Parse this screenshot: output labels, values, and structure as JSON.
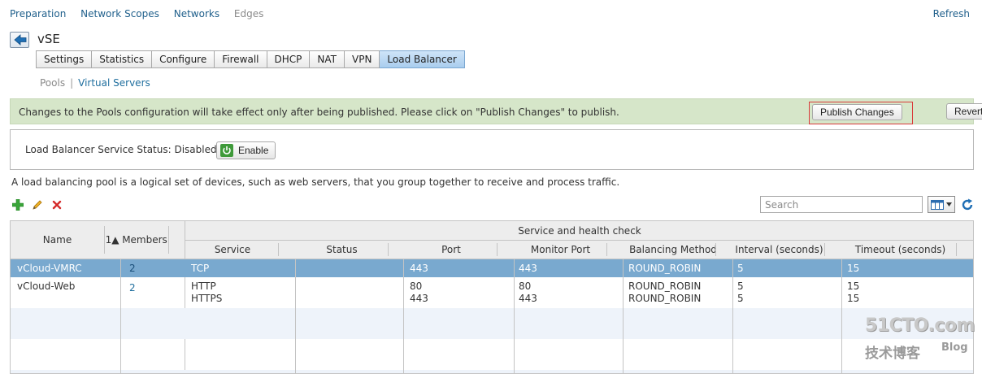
{
  "nav": {
    "links": [
      "Preparation",
      "Network Scopes",
      "Networks",
      "Edges"
    ],
    "refresh": "Refresh"
  },
  "page": {
    "title": "vSE"
  },
  "tabs": [
    "Settings",
    "Statistics",
    "Configure",
    "Firewall",
    "DHCP",
    "NAT",
    "VPN",
    "Load Balancer"
  ],
  "active_tab": "Load Balancer",
  "subnav": {
    "pools": "Pools",
    "virtual_servers": "Virtual Servers"
  },
  "banner": {
    "message": "Changes to the Pools configuration will take effect only after being published. Please click on \"Publish Changes\" to publish.",
    "publish": "Publish Changes",
    "revert": "Revert"
  },
  "service_status": {
    "label": "Load Balancer Service Status:",
    "value": "Disabled",
    "enable": "Enable"
  },
  "description": "A load balancing pool is a logical set of devices, such as web servers, that you group together to receive and process traffic.",
  "search": {
    "placeholder": "Search"
  },
  "colors": {
    "banner": "#d6e6c9",
    "selected_row": "#79a9cf",
    "active_tab": "#a9cdee",
    "publish_outline": "#d93a3a"
  },
  "grid": {
    "group_header": "Service and health check",
    "columns": {
      "name": "Name",
      "sort": "1▲",
      "members": "Members",
      "service": "Service",
      "status": "Status",
      "port": "Port",
      "monitor_port": "Monitor Port",
      "balancing_method": "Balancing Method",
      "interval": "Interval (seconds)",
      "timeout": "Timeout (seconds)"
    },
    "rows": [
      {
        "name": "vCloud-VMRC",
        "members": "2",
        "service": [
          "TCP"
        ],
        "status": "",
        "port": [
          "443"
        ],
        "monitor_port": [
          "443"
        ],
        "method": [
          "ROUND_ROBIN"
        ],
        "interval": [
          "5"
        ],
        "timeout": [
          "15"
        ]
      },
      {
        "name": "vCloud-Web",
        "members": "2",
        "service": [
          "HTTP",
          "HTTPS"
        ],
        "status": "",
        "port": [
          "80",
          "443"
        ],
        "monitor_port": [
          "80",
          "443"
        ],
        "method": [
          "ROUND_ROBIN",
          "ROUND_ROBIN"
        ],
        "interval": [
          "5",
          "5"
        ],
        "timeout": [
          "15",
          "15"
        ]
      }
    ]
  },
  "watermark": {
    "site": "51CTO.com",
    "chinese": "技术博客",
    "blog": "Blog"
  }
}
